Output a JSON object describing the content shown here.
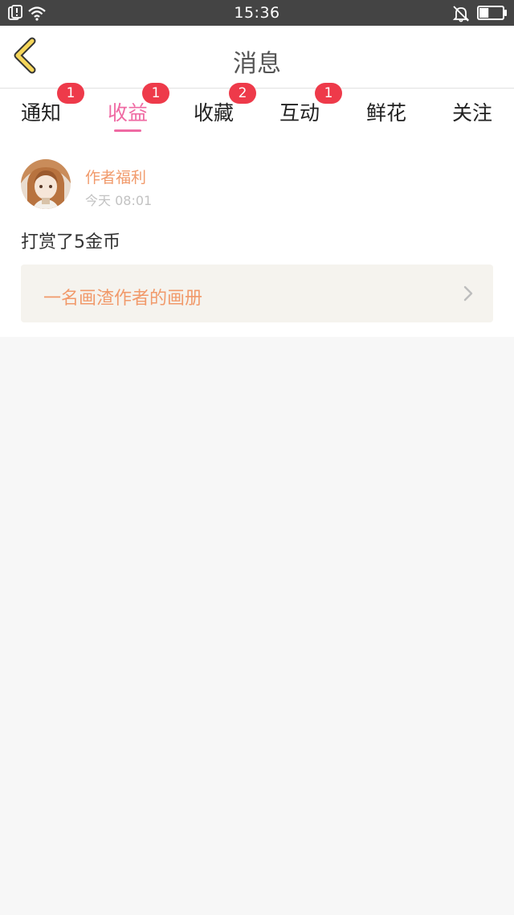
{
  "status_bar": {
    "time": "15:36",
    "icons": [
      "notification-alert-icon",
      "wifi-icon",
      "bell-muted-icon",
      "battery-icon"
    ],
    "battery_level": 0.4
  },
  "header": {
    "title": "消息",
    "back_icon": "chevron-left-icon"
  },
  "tabs": [
    {
      "label": "通知",
      "badge": "1",
      "active": false
    },
    {
      "label": "收益",
      "badge": "1",
      "active": true
    },
    {
      "label": "收藏",
      "badge": "2",
      "active": false
    },
    {
      "label": "互动",
      "badge": "1",
      "active": false
    },
    {
      "label": "鲜花",
      "badge": "",
      "active": false
    },
    {
      "label": "关注",
      "badge": "",
      "active": false
    }
  ],
  "message": {
    "sender": "作者福利",
    "time": "今天 08:01",
    "body": "打赏了5金币",
    "album_title": "一名画渣作者的画册"
  },
  "colors": {
    "accent_pink": "#ef6aa3",
    "badge_red": "#ee3a4a",
    "sender_orange": "#f19a6b",
    "back_yellow": "#f5d65a"
  }
}
